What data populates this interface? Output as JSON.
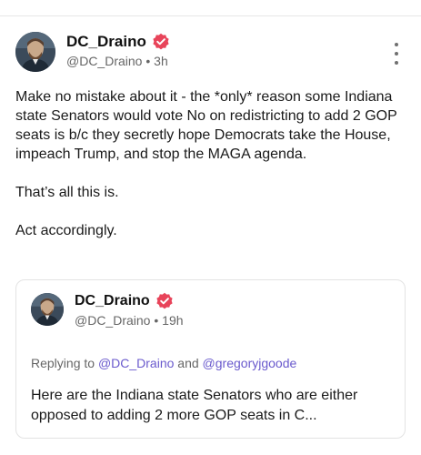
{
  "post": {
    "display_name": "DC_Draino",
    "handle": "@DC_Draino",
    "time": "3h",
    "body": "Make no mistake about it - the *only* reason some Indiana state Senators would vote No on redistricting to add 2 GOP seats is b/c they secretly hope Democrats take the House, impeach Trump, and stop the MAGA agenda.\n\nThat’s all this is.\n\nAct accordingly."
  },
  "quoted": {
    "display_name": "DC_Draino",
    "handle": "@DC_Draino",
    "time": "19h",
    "replying_prefix": "Replying to",
    "mention_1": "@DC_Draino",
    "and_word": "and",
    "mention_2": "@gregoryjgoode",
    "text": "Here are the Indiana state Senators who are either opposed to adding 2 more GOP seats in C..."
  },
  "icons": {
    "verified": "verified-badge-icon",
    "more": "more-vertical-icon"
  },
  "colors": {
    "verified": "#e8445a",
    "mention": "#6a5acd",
    "meta": "#666666"
  }
}
